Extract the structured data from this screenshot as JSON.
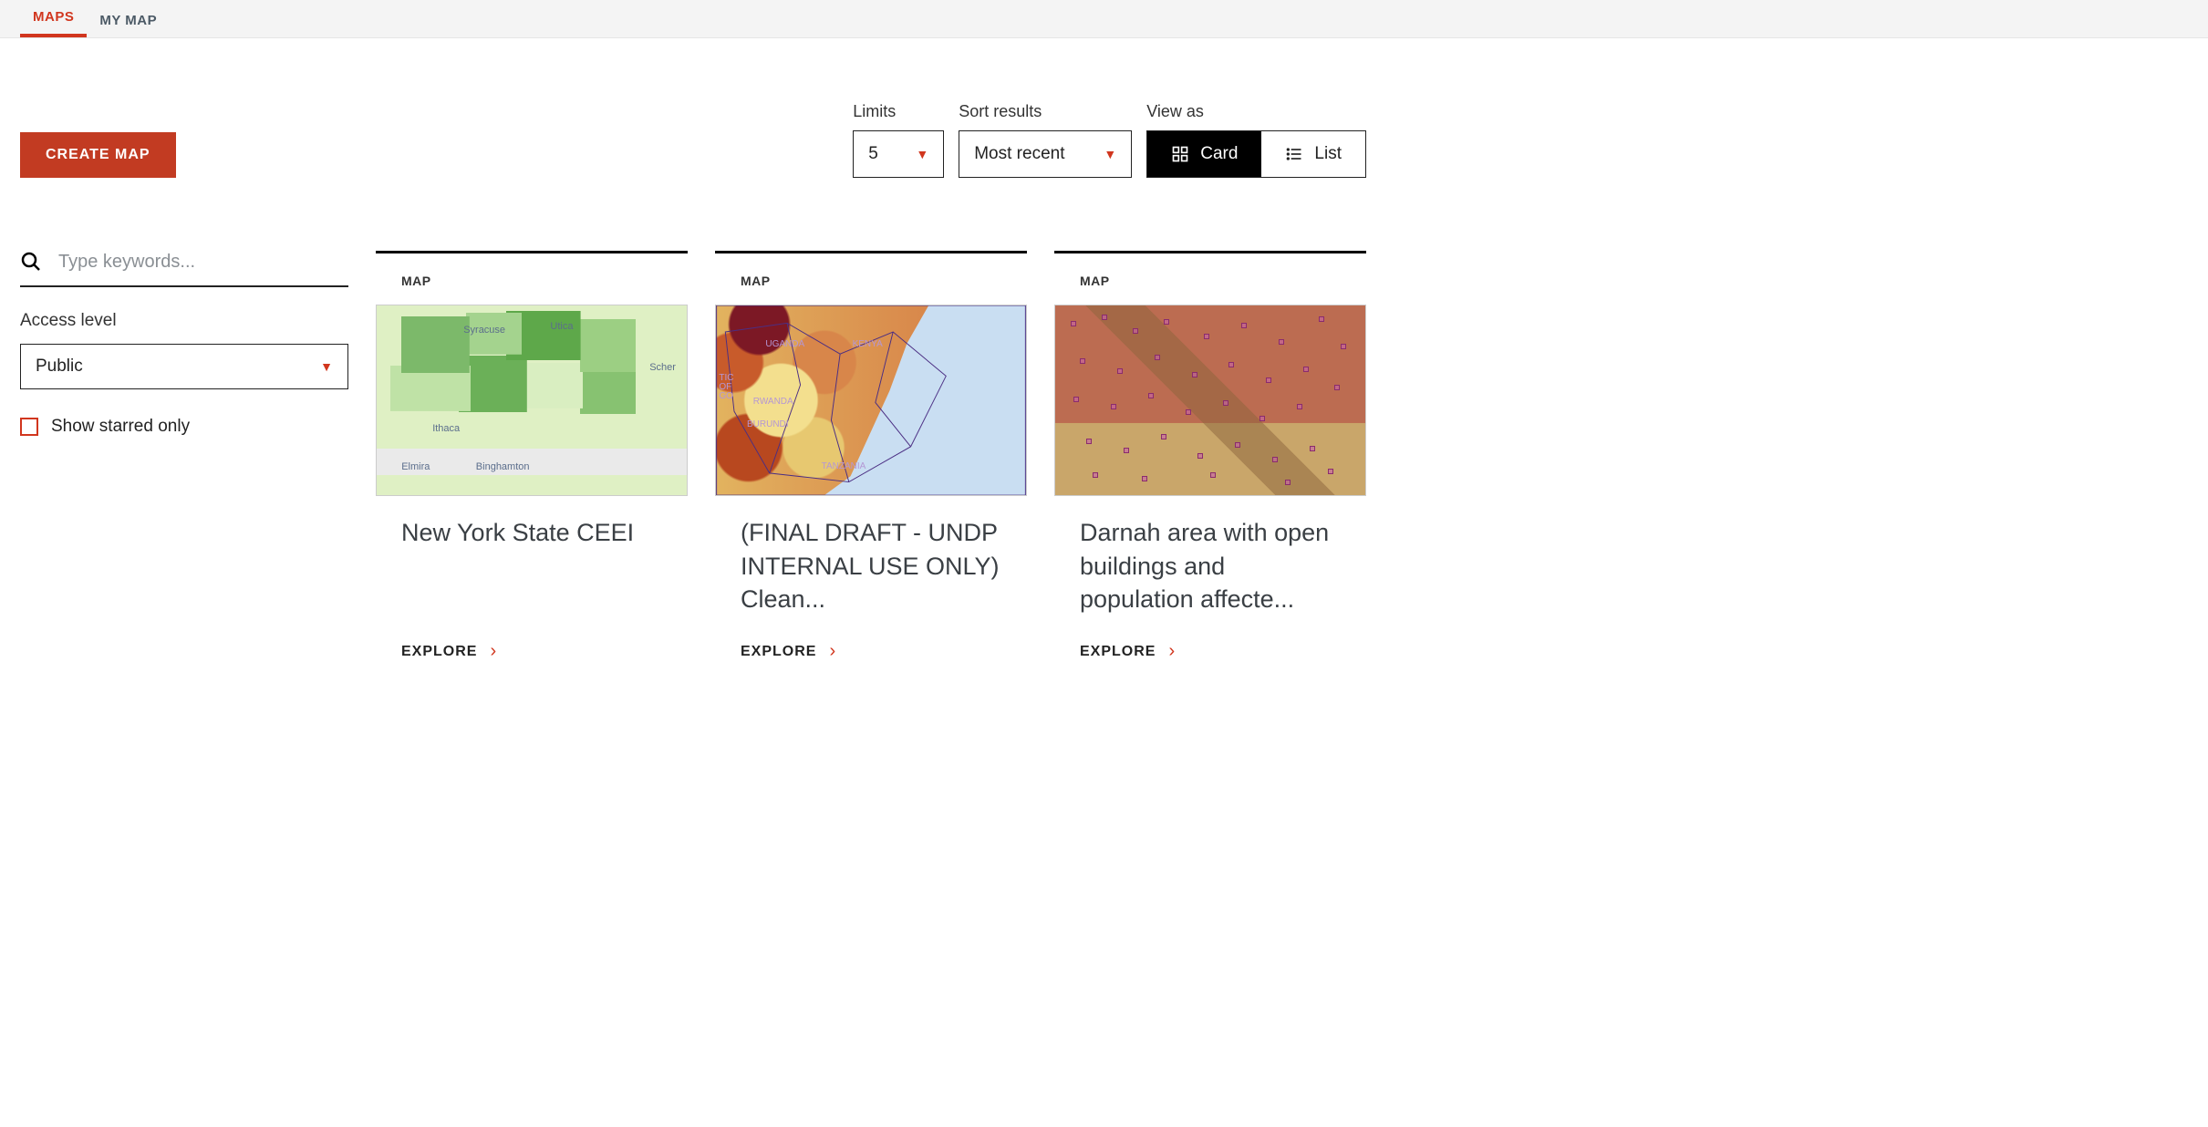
{
  "tabs": {
    "maps": "MAPS",
    "mymap": "MY MAP"
  },
  "create_label": "CREATE MAP",
  "controls": {
    "limits_label": "Limits",
    "limits_value": "5",
    "sort_label": "Sort results",
    "sort_value": "Most recent",
    "viewas_label": "View as",
    "viewas_card": "Card",
    "viewas_list": "List"
  },
  "sidebar": {
    "search_placeholder": "Type keywords...",
    "access_label": "Access level",
    "access_value": "Public",
    "starred_label": "Show starred only"
  },
  "cards": {
    "type_label": "MAP",
    "explore_label": "EXPLORE",
    "items": [
      {
        "title": "New York State CEEI"
      },
      {
        "title": "(FINAL DRAFT - UNDP INTERNAL USE ONLY) Clean..."
      },
      {
        "title": "Darnah area with open buildings and population affecte..."
      }
    ]
  },
  "thumb_labels": {
    "ny": [
      "Syracuse",
      "Utica",
      "Scher",
      "Ithaca",
      "Elmira",
      "Binghamton"
    ],
    "ke": [
      "UGANDA",
      "KENYA",
      "RWANDA",
      "BURUNDI",
      "TANZANIA",
      "TIC OF GO"
    ]
  }
}
